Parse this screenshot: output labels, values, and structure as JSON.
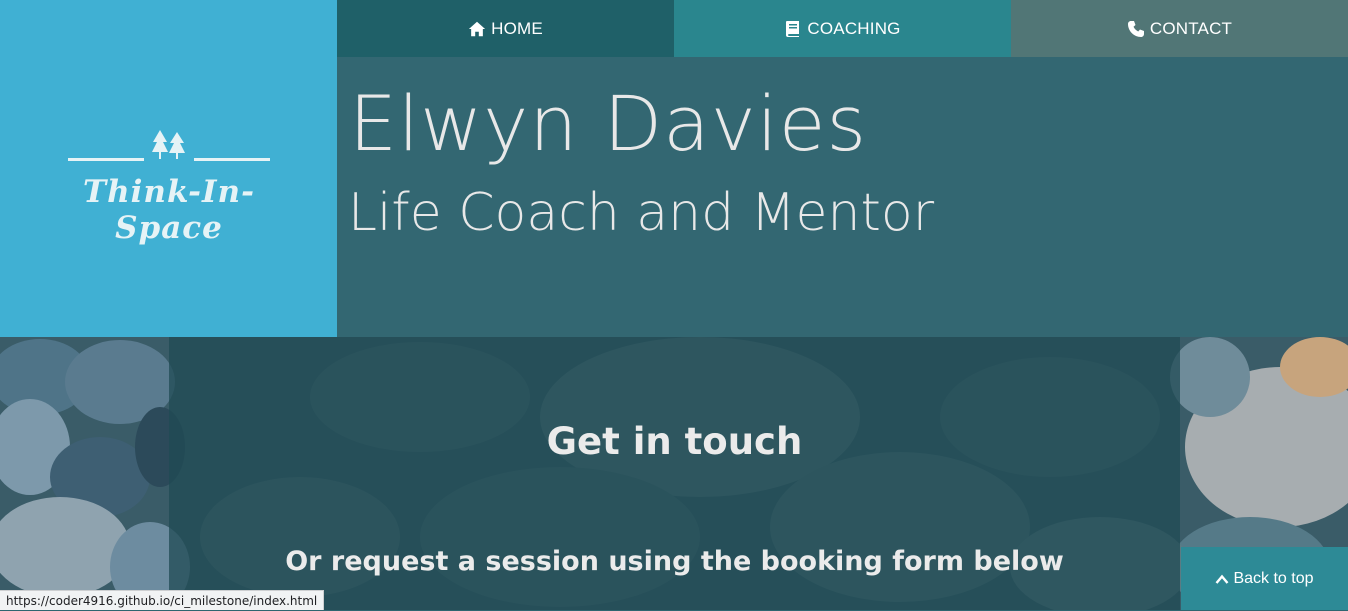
{
  "logo": {
    "text": "Think-In-Space",
    "icon": "trees-icon"
  },
  "nav": {
    "items": [
      {
        "label": "HOME",
        "icon": "home-icon"
      },
      {
        "label": "COACHING",
        "icon": "book-icon"
      },
      {
        "label": "CONTACT",
        "icon": "phone-icon"
      }
    ]
  },
  "hero": {
    "name": "Elwyn Davies",
    "subtitle": "Life Coach and Mentor"
  },
  "contact": {
    "title": "Get in touch",
    "subtitle": "Or request a session using the booking form below"
  },
  "back_to_top": {
    "label": "Back to top",
    "icon": "chevron-up-icon"
  },
  "status_bar": {
    "url": "https://coder4916.github.io/ci_milestone/index.html"
  },
  "colors": {
    "logo_bg": "#40b0d3",
    "nav_home": "#1f6068",
    "nav_coaching": "#2a868e",
    "nav_contact": "#517676",
    "hero_bg": "#336772",
    "back_to_top_bg": "#2d8a96"
  }
}
